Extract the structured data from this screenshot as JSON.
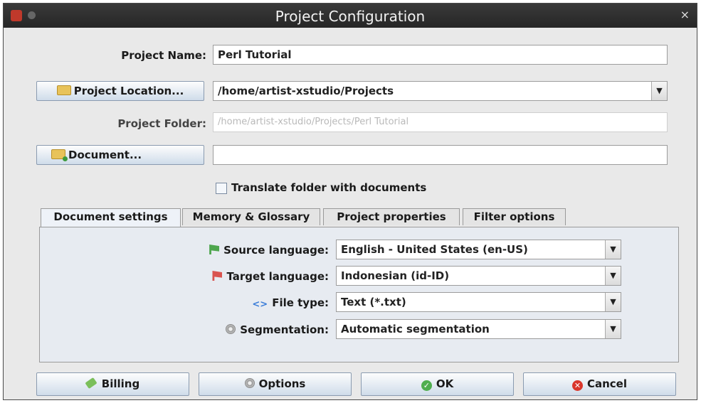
{
  "window": {
    "title": "Project Configuration",
    "close_glyph": "×"
  },
  "form": {
    "project_name_label": "Project Name:",
    "project_name_value": "Perl Tutorial",
    "project_location_button": "Project Location...",
    "project_location_value": "/home/artist-xstudio/Projects",
    "project_folder_label": "Project Folder:",
    "project_folder_value": "/home/artist-xstudio/Projects/Perl Tutorial",
    "document_button": "Document...",
    "document_value": "",
    "translate_checkbox_label": "Translate folder with documents",
    "translate_checkbox_checked": false
  },
  "tabs": [
    {
      "label": "Document settings",
      "active": true
    },
    {
      "label": "Memory & Glossary",
      "active": false
    },
    {
      "label": "Project properties",
      "active": false
    },
    {
      "label": "Filter options",
      "active": false
    }
  ],
  "document_settings": {
    "source_language_label": "Source language:",
    "source_language_value": "English - United States (en-US)",
    "target_language_label": "Target language:",
    "target_language_value": "Indonesian (id-ID)",
    "file_type_label": "File type:",
    "file_type_value": "Text (*.txt)",
    "segmentation_label": "Segmentation:",
    "segmentation_value": "Automatic segmentation"
  },
  "buttons": {
    "billing": "Billing",
    "options": "Options",
    "ok": "OK",
    "cancel": "Cancel"
  },
  "icons": {
    "folder": "folder-icon",
    "document": "folder-document-icon",
    "source_flag": "green-flag-icon",
    "target_flag": "red-flag-icon",
    "file_type": "code-icon",
    "segmentation": "gear-icon",
    "billing": "pencil-icon",
    "options": "gear-icon",
    "ok": "check-circle-icon",
    "cancel": "x-circle-icon"
  },
  "colors": {
    "titlebar": "#2f2f2f",
    "dialog_bg": "#e9e9e9",
    "button_gradient_bottom": "#cfdcea",
    "ok_green": "#4fae4f",
    "cancel_red": "#d9362b"
  }
}
